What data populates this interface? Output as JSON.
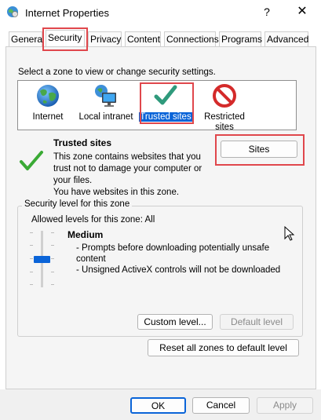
{
  "window": {
    "title": "Internet Properties",
    "help_label": "?",
    "close_label": "✕"
  },
  "tabs": [
    {
      "label": "General"
    },
    {
      "label": "Security"
    },
    {
      "label": "Privacy"
    },
    {
      "label": "Content"
    },
    {
      "label": "Connections"
    },
    {
      "label": "Programs"
    },
    {
      "label": "Advanced"
    }
  ],
  "zones": {
    "instruction": "Select a zone to view or change security settings.",
    "items": [
      {
        "label": "Internet",
        "icon": "globe-icon"
      },
      {
        "label": "Local intranet",
        "icon": "network-computer-icon"
      },
      {
        "label": "Trusted sites",
        "icon": "checkmark-icon"
      },
      {
        "label": "Restricted sites",
        "icon": "no-entry-icon"
      }
    ]
  },
  "zone_details": {
    "title": "Trusted sites",
    "description_1": "This zone contains websites that you",
    "description_2": "trust not to damage your computer or",
    "description_3": "your files.",
    "description_4": "You have websites in this zone.",
    "sites_button": "Sites"
  },
  "security_level": {
    "group_label": "Security level for this zone",
    "allowed": "Allowed levels for this zone: All",
    "level_name": "Medium",
    "bullet_1a": "- Prompts before downloading potentially unsafe",
    "bullet_1b": "content",
    "bullet_2": "- Unsigned ActiveX controls will not be downloaded",
    "level_fraction": 0.5,
    "custom_button": "Custom level...",
    "default_button": "Default level"
  },
  "reset_button": "Reset all zones to default level",
  "footer": {
    "ok": "OK",
    "cancel": "Cancel",
    "apply": "Apply"
  },
  "colors": {
    "highlight_red": "#e0474c",
    "selection_blue": "#0a64d8",
    "check_green": "#3aaa35",
    "slider_blue": "#0a64d8"
  }
}
